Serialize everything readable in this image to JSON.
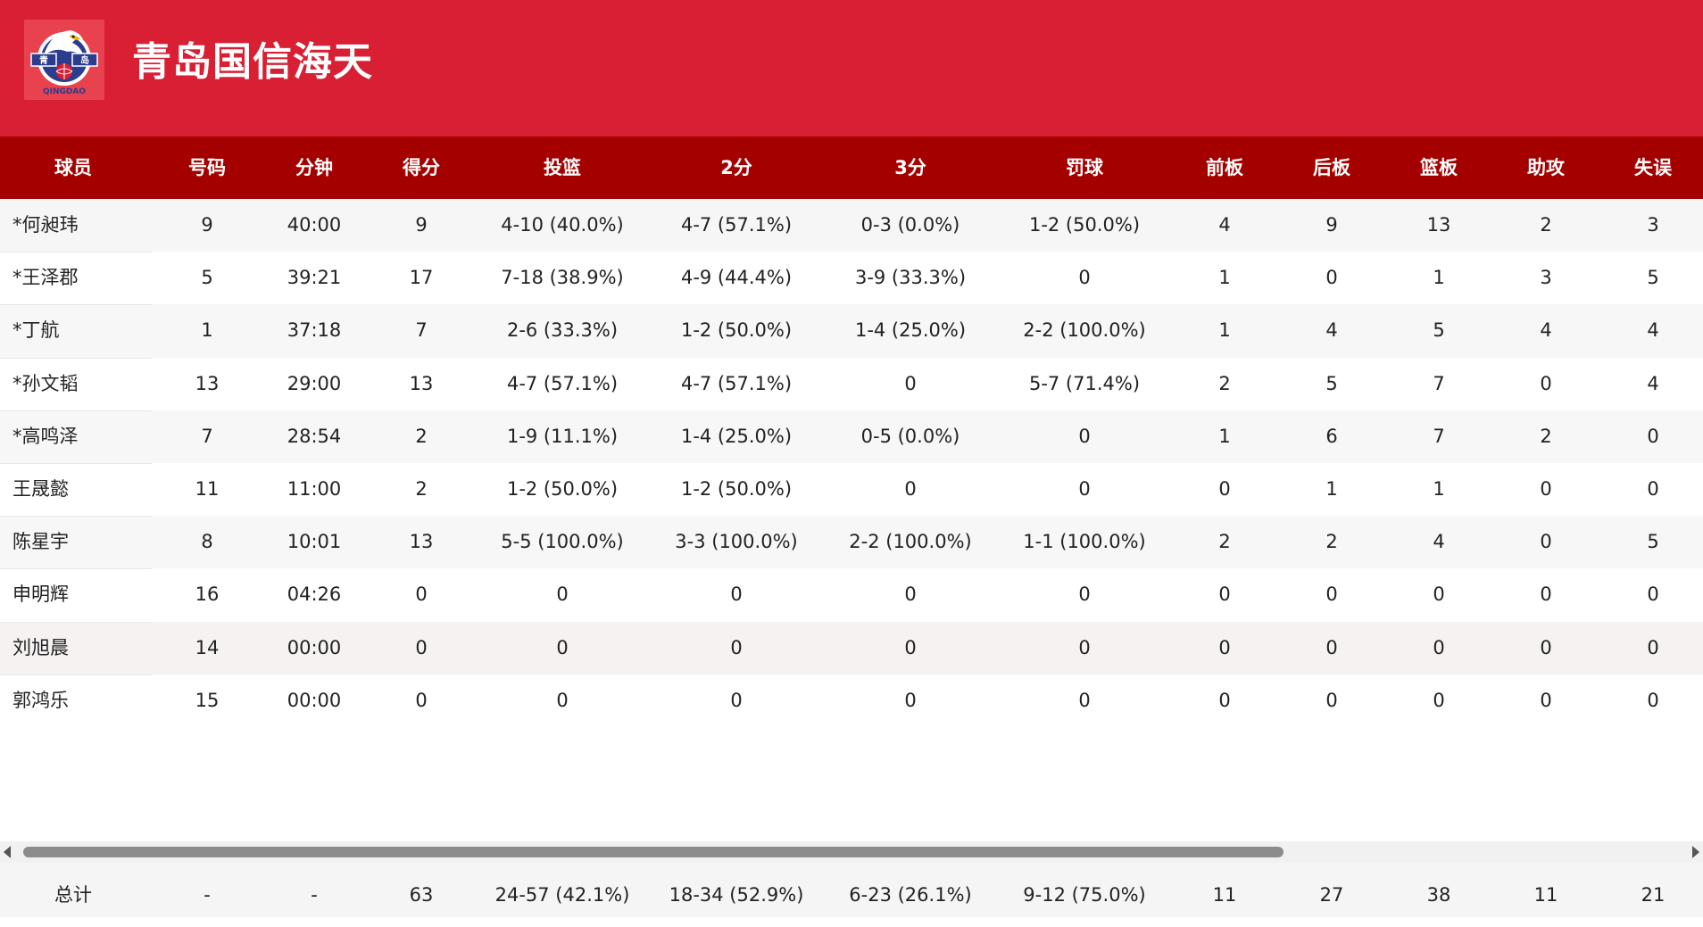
{
  "team": {
    "name": "青岛国信海天",
    "logo_text_top": "青",
    "logo_text_right": "岛",
    "logo_text_bottom": "QINGDAO",
    "colors": {
      "header": "#d81f33",
      "table_header": "#a50000"
    }
  },
  "columns": [
    "球员",
    "号码",
    "分钟",
    "得分",
    "投篮",
    "2分",
    "3分",
    "罚球",
    "前板",
    "后板",
    "篮板",
    "助攻",
    "失误"
  ],
  "rows": [
    [
      "*何昶玮",
      "9",
      "40:00",
      "9",
      "4-10 (40.0%)",
      "4-7 (57.1%)",
      "0-3 (0.0%)",
      "1-2 (50.0%)",
      "4",
      "9",
      "13",
      "2",
      "3"
    ],
    [
      "*王泽郡",
      "5",
      "39:21",
      "17",
      "7-18 (38.9%)",
      "4-9 (44.4%)",
      "3-9 (33.3%)",
      "0",
      "1",
      "0",
      "1",
      "3",
      "5"
    ],
    [
      " *丁航",
      "1",
      "37:18",
      "7",
      "2-6 (33.3%)",
      "1-2 (50.0%)",
      "1-4 (25.0%)",
      "2-2 (100.0%)",
      "1",
      "4",
      "5",
      "4",
      "4"
    ],
    [
      "*孙文韬",
      "13",
      "29:00",
      "13",
      "4-7 (57.1%)",
      "4-7 (57.1%)",
      "0",
      "5-7 (71.4%)",
      "2",
      "5",
      "7",
      "0",
      "4"
    ],
    [
      "*高鸣泽",
      "7",
      "28:54",
      "2",
      "1-9 (11.1%)",
      "1-4 (25.0%)",
      "0-5 (0.0%)",
      "0",
      "1",
      "6",
      "7",
      "2",
      "0"
    ],
    [
      "王晟懿",
      "11",
      "11:00",
      "2",
      "1-2 (50.0%)",
      "1-2 (50.0%)",
      "0",
      "0",
      "0",
      "1",
      "1",
      "0",
      "0"
    ],
    [
      "陈星宇",
      "8",
      "10:01",
      "13",
      "5-5 (100.0%)",
      "3-3 (100.0%)",
      "2-2 (100.0%)",
      "1-1 (100.0%)",
      "2",
      "2",
      "4",
      "0",
      "5"
    ],
    [
      "申明辉",
      "16",
      "04:26",
      "0",
      "0",
      "0",
      "0",
      "0",
      "0",
      "0",
      "0",
      "0",
      "0"
    ],
    [
      "刘旭晨",
      "14",
      "00:00",
      "0",
      "0",
      "0",
      "0",
      "0",
      "0",
      "0",
      "0",
      "0",
      "0"
    ],
    [
      "郭鸿乐",
      "15",
      "00:00",
      "0",
      "0",
      "0",
      "0",
      "0",
      "0",
      "0",
      "0",
      "0",
      "0"
    ]
  ],
  "totals": [
    "总计",
    "-",
    "-",
    "63",
    "24-57 (42.1%)",
    "18-34 (52.9%)",
    "6-23 (26.1%)",
    "9-12 (75.0%)",
    "11",
    "27",
    "38",
    "11",
    "21"
  ]
}
